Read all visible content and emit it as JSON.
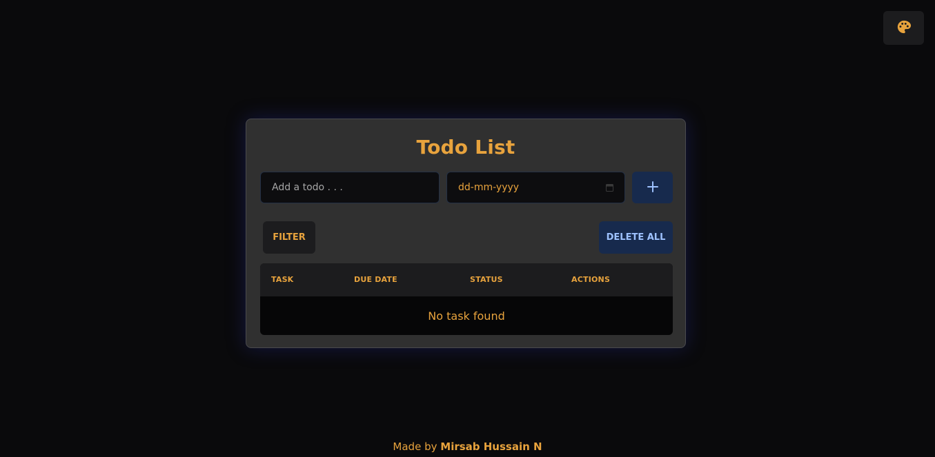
{
  "header": {
    "theme_icon": "palette-icon"
  },
  "card": {
    "title": "Todo List",
    "todo_input": {
      "placeholder": "Add a todo . . .",
      "value": ""
    },
    "date_input": {
      "placeholder": "dd-mm-yyyy",
      "icon": "calendar-icon"
    },
    "add_button": {
      "label": "+",
      "icon": "plus-icon"
    },
    "filter_button": "FILTER",
    "delete_all_button": "DELETE ALL",
    "table": {
      "columns": [
        "TASK",
        "DUE DATE",
        "STATUS",
        "ACTIONS"
      ],
      "empty_message": "No task found"
    }
  },
  "footer": {
    "prefix": "Made by",
    "author": "Mirsab Hussain N"
  },
  "colors": {
    "accent": "#e8a33d",
    "background": "#0a0a0c",
    "card": "#303030",
    "button_primary": "#172a4d",
    "button_primary_text": "#9ec2ff"
  }
}
